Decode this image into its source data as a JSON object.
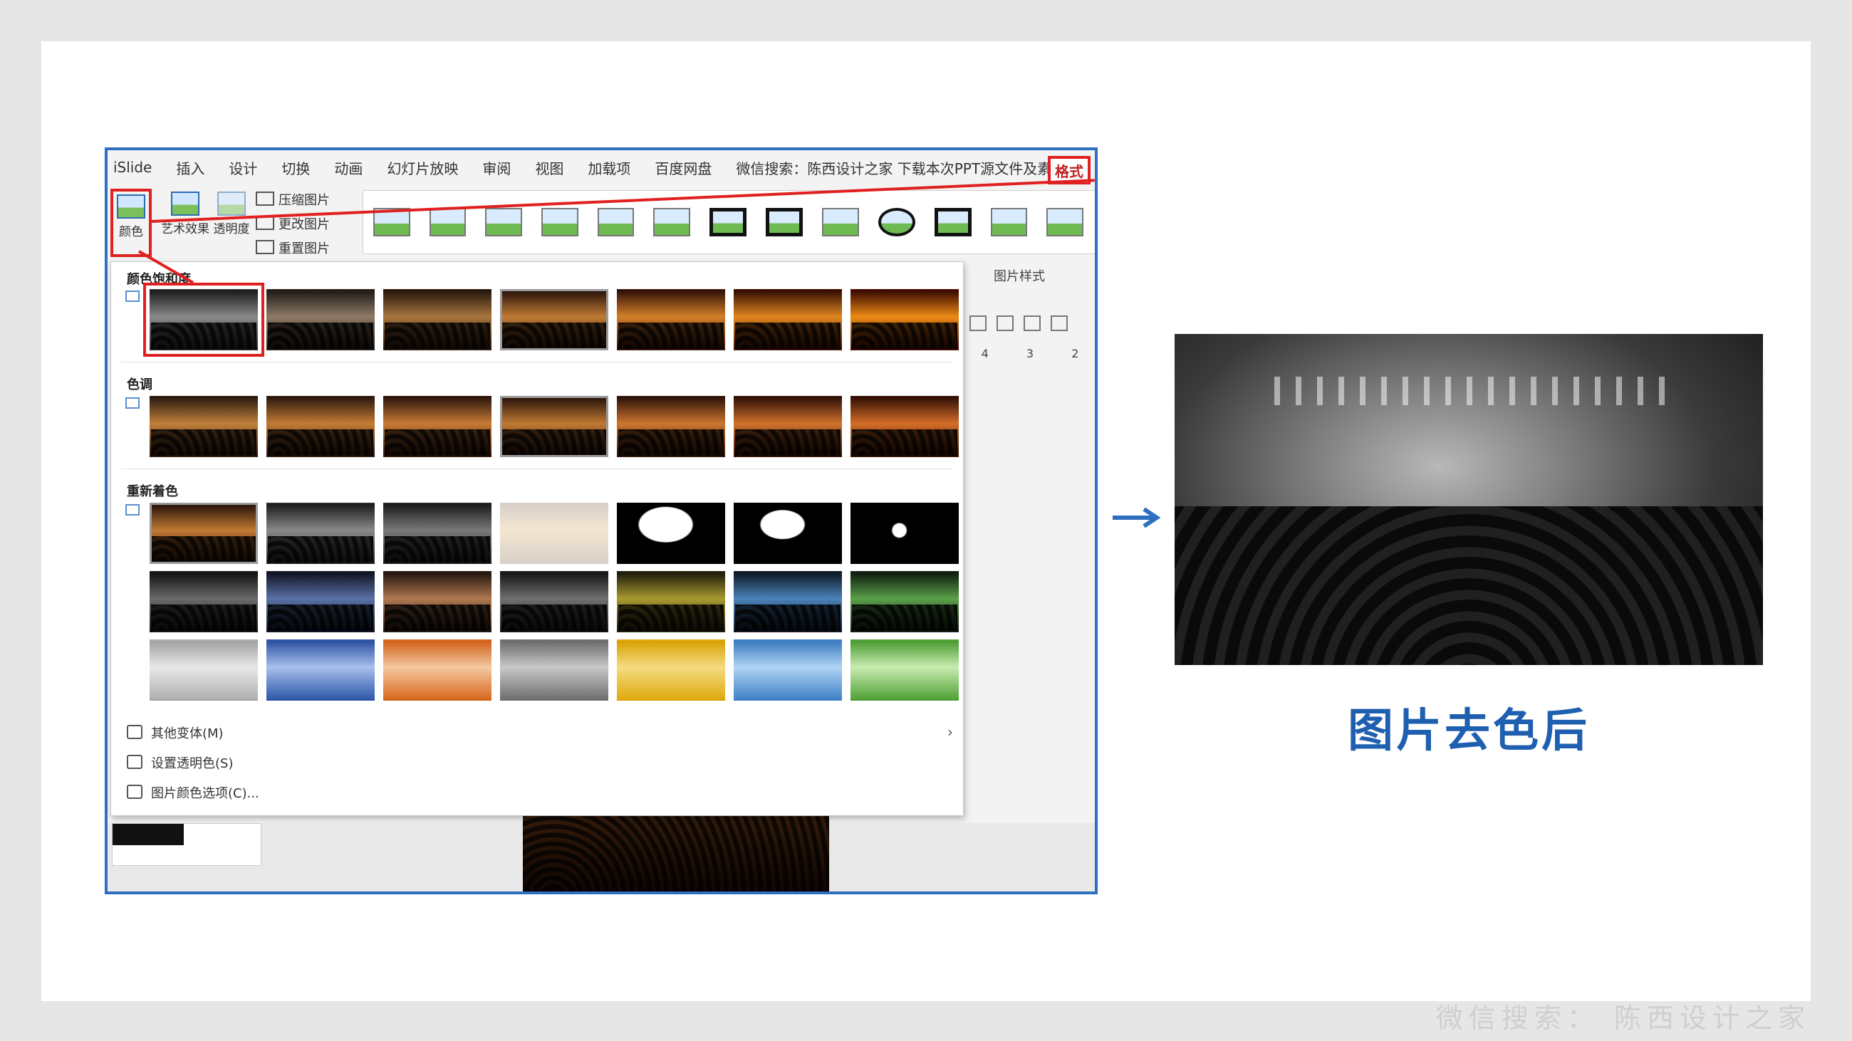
{
  "watermark": "微信搜索： 陈西设计之家",
  "menubar": {
    "items": [
      "iSlide",
      "插入",
      "设计",
      "切换",
      "动画",
      "幻灯片放映",
      "审阅",
      "视图",
      "加载项",
      "百度网盘",
      "微信搜索：陈西设计之家  下载本次PPT源文件及素材"
    ],
    "format_tab": "格式"
  },
  "ribbon": {
    "color_label": "颜色",
    "artistic_label": "艺术效果",
    "transparency_label": "透明度",
    "compress_label": "压缩图片",
    "change_label": "更改图片",
    "reset_label": "重置图片",
    "styles_label": "图片样式"
  },
  "panel": {
    "saturation_title": "颜色饱和度",
    "tone_title": "色调",
    "recolor_title": "重新着色",
    "more_variations": "其他变体(M)",
    "set_transparent": "设置透明色(S)",
    "color_options": "图片颜色选项(C)..."
  },
  "ruler": [
    "4",
    "3",
    "2"
  ],
  "caption": "图片去色后",
  "colors": {
    "accent_blue": "#2f6fc0",
    "highlight_red": "#e02020",
    "caption_blue": "#1f5fb0"
  }
}
